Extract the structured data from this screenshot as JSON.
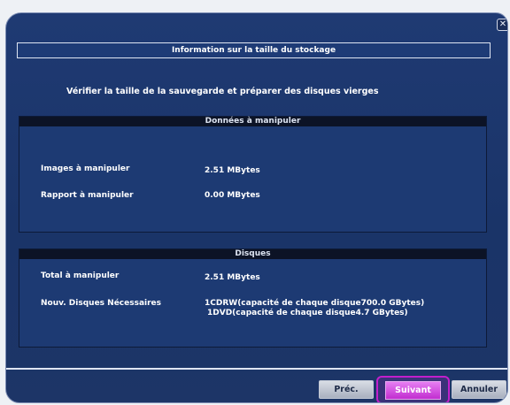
{
  "window": {
    "title": "Information sur la taille du stockage",
    "subtitle": "Vérifier la taille de la sauvegarde et préparer des disques vierges",
    "close_glyph": "✕"
  },
  "data_section": {
    "header": "Données à manipuler",
    "rows": [
      {
        "label": "Images à manipuler",
        "value": "2.51 MBytes"
      },
      {
        "label": "Rapport à manipuler",
        "value": "0.00 MBytes"
      }
    ]
  },
  "disks_section": {
    "header": "Disques",
    "total_label": "Total à manipuler",
    "total_value": "2.51 MBytes",
    "needed_label": "Nouv. Disques Nécessaires",
    "needed_values": [
      "1CDRW(capacité de chaque disque700.0 GBytes)",
      "1DVD(capacité de chaque disque4.7 GBytes)"
    ]
  },
  "buttons": {
    "prev": "Préc.",
    "next": "Suivant",
    "cancel": "Annuler"
  }
}
